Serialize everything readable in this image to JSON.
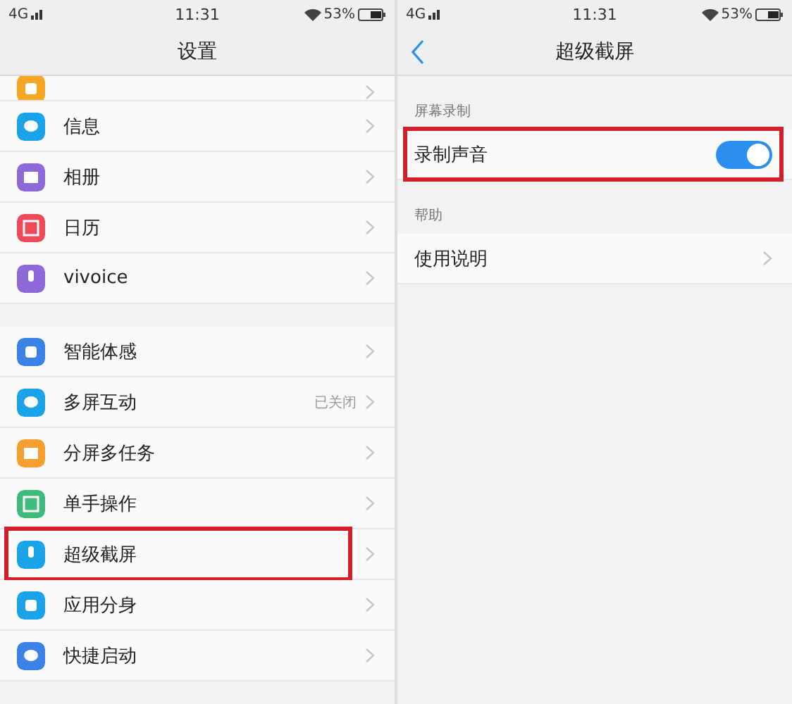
{
  "screens": [
    {
      "status_bar": {
        "network": "4G",
        "time": "11:31",
        "battery": "53%"
      },
      "header": {
        "title": "设置",
        "back": false
      },
      "groups": [
        {
          "items": [
            {
              "kind": "clipped",
              "color": "#f5a623"
            },
            {
              "kind": "link",
              "label": "信息",
              "color": "#1aa3e8",
              "highlighted": false
            },
            {
              "kind": "link",
              "label": "相册",
              "color": "#8e6ad8",
              "highlighted": false
            },
            {
              "kind": "link",
              "label": "日历",
              "color": "#ee4a5a",
              "highlighted": false
            },
            {
              "kind": "link",
              "label": "vivoice",
              "color": "#8e6ad8",
              "highlighted": false
            }
          ]
        },
        {
          "items": [
            {
              "kind": "link",
              "label": "智能体感",
              "color": "#3b82e8",
              "highlighted": false
            },
            {
              "kind": "link",
              "label": "多屏互动",
              "value": "已关闭",
              "color": "#1aa3e8",
              "highlighted": false
            },
            {
              "kind": "link",
              "label": "分屏多任务",
              "color": "#f5a030",
              "highlighted": false
            },
            {
              "kind": "link",
              "label": "单手操作",
              "color": "#3dbb7a",
              "highlighted": false
            },
            {
              "kind": "link",
              "label": "超级截屏",
              "color": "#1aa3e8",
              "highlighted": true
            },
            {
              "kind": "link",
              "label": "应用分身",
              "color": "#1aa3e8",
              "highlighted": false
            },
            {
              "kind": "link",
              "label": "快捷启动",
              "color": "#3b82e8",
              "highlighted": false
            }
          ]
        }
      ]
    },
    {
      "status_bar": {
        "network": "4G",
        "time": "11:31",
        "battery": "53%"
      },
      "header": {
        "title": "超级截屏",
        "back": true
      },
      "groups": [
        {
          "heading": "屏幕录制",
          "items": [
            {
              "kind": "toggle",
              "label": "录制声音",
              "on": true,
              "highlighted": true
            }
          ]
        },
        {
          "heading": "帮助",
          "items": [
            {
              "kind": "link",
              "label": "使用说明",
              "highlighted": false
            }
          ]
        }
      ]
    }
  ]
}
